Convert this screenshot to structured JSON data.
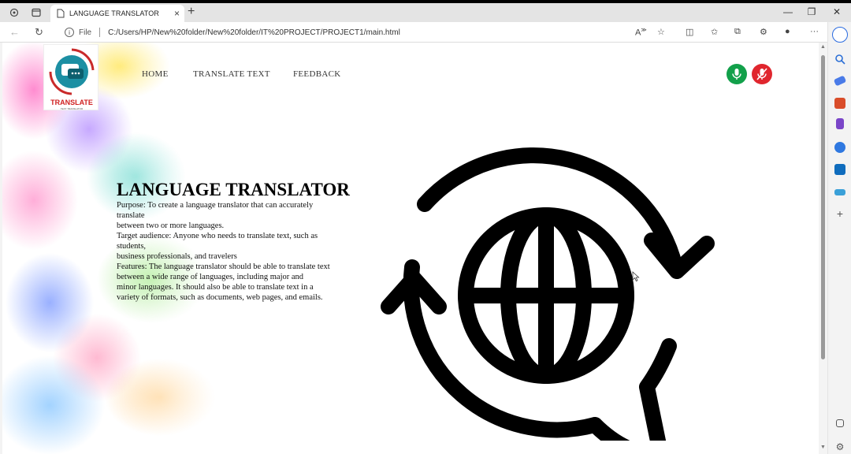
{
  "browser": {
    "tab_title": "LANGUAGE TRANSLATOR",
    "url_scheme": "File",
    "url": "C:/Users/HP/New%20folder/New%20folder/IT%20PROJECT/PROJECT1/main.html"
  },
  "logo": {
    "text": "TRANSLATE",
    "tagline": "TEXT TRANSLATOR"
  },
  "nav": {
    "items": [
      "HOME",
      "TRANSLATE TEXT",
      "FEEDBACK"
    ]
  },
  "mic": {
    "on_color": "#12a04a",
    "off_color": "#e0262e"
  },
  "hero": {
    "title": "LANGUAGE TRANSLATOR",
    "lines": [
      "Purpose: To create a language translator that can accurately translate",
      "between two or more languages.",
      "Target audience: Anyone who needs to translate text, such as students,",
      "business professionals, and travelers",
      "Features: The language translator should be able to translate text",
      "between a wide range of languages, including major and",
      "minor languages. It should also be able to translate text in a",
      "variety of formats, such as documents, web pages, and emails."
    ]
  },
  "icons": {
    "hero": "globe-translate-icon",
    "mic_on": "microphone-icon",
    "mic_off": "microphone-off-icon"
  }
}
